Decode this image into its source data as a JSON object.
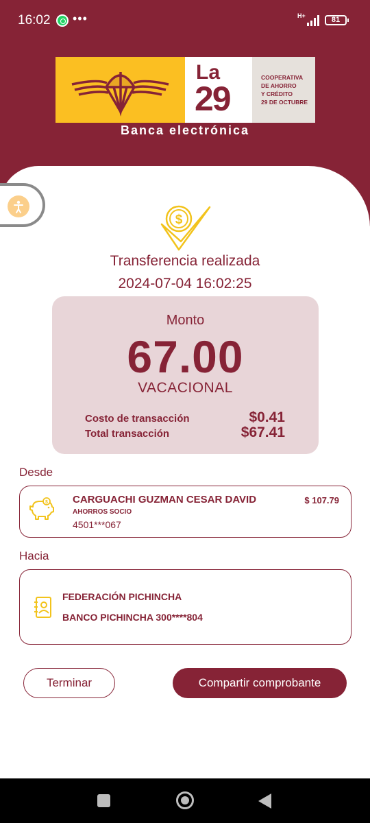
{
  "status_bar": {
    "time": "16:02",
    "network": "H+",
    "battery": "81",
    "icons": [
      "whatsapp-icon",
      "more-dots-icon",
      "signal-icon",
      "battery-icon"
    ]
  },
  "brand": {
    "logo_la": "La",
    "logo_number": "29",
    "coop_line1": "COOPERATIVA",
    "coop_line2": "DE AHORRO",
    "coop_line3": "Y CRÉDITO",
    "coop_line4": "29 DE OCTUBRE",
    "subtitle": "Banca electrónica",
    "colors": {
      "primary": "#862336",
      "accent": "#fbbf22",
      "panel": "#e8d5d8"
    }
  },
  "receipt": {
    "status": "Transferencia realizada",
    "datetime": "2024-07-04 16:02:25",
    "amount_label": "Monto",
    "amount": "67.00",
    "concept": "VACACIONAL",
    "fee_label": "Costo de transacción",
    "fee_value": "$0.41",
    "total_label": "Total transacción",
    "total_value": "$67.41"
  },
  "from": {
    "section_label": "Desde",
    "name": "CARGUACHI GUZMAN CESAR DAVID",
    "balance": "$ 107.79",
    "account_type": "AHORROS SOCIO",
    "account_number": "4501***067",
    "icon": "piggy-bank-icon"
  },
  "to": {
    "section_label": "Hacia",
    "name": "FEDERACIÓN PICHINCHA",
    "bank_account": "BANCO PICHINCHA 300****804",
    "icon": "contact-book-icon"
  },
  "actions": {
    "finish": "Terminar",
    "share": "Compartir comprobante"
  }
}
